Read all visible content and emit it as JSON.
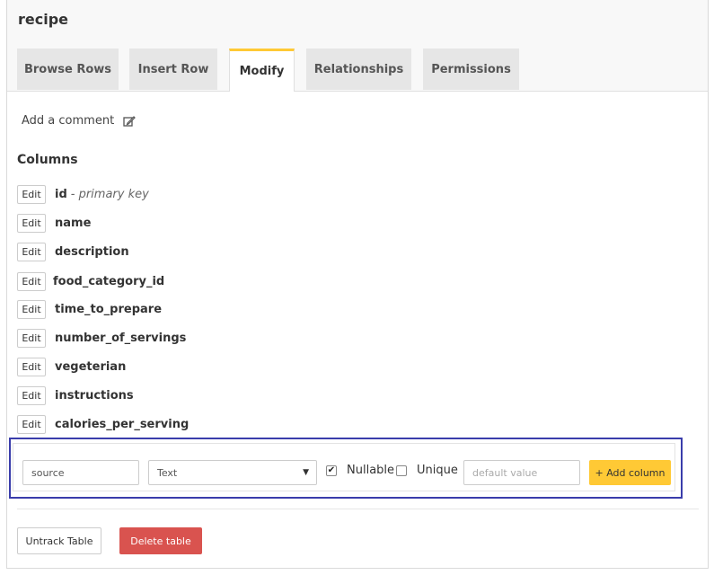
{
  "table_name": "recipe",
  "tabs": [
    {
      "label": "Browse Rows",
      "active": false
    },
    {
      "label": "Insert Row",
      "active": false
    },
    {
      "label": "Modify",
      "active": true
    },
    {
      "label": "Relationships",
      "active": false
    },
    {
      "label": "Permissions",
      "active": false
    }
  ],
  "comment": {
    "label": "Add a comment",
    "icon": "edit-icon"
  },
  "columns_section": {
    "title": "Columns",
    "edit_label": "Edit",
    "items": [
      {
        "name": "id",
        "note": "- primary key"
      },
      {
        "name": "name",
        "note": ""
      },
      {
        "name": "description",
        "note": ""
      },
      {
        "name": "food_category_id",
        "note": ""
      },
      {
        "name": "time_to_prepare",
        "note": ""
      },
      {
        "name": "number_of_servings",
        "note": ""
      },
      {
        "name": "vegeterian",
        "note": ""
      },
      {
        "name": "instructions",
        "note": ""
      },
      {
        "name": "calories_per_serving",
        "note": ""
      }
    ]
  },
  "add_column": {
    "name_value": "source",
    "type_value": "Text",
    "nullable_label": "Nullable",
    "nullable_checked": true,
    "unique_label": "Unique",
    "unique_checked": false,
    "default_placeholder": "default value",
    "button_label": "+ Add column"
  },
  "footer": {
    "untrack_label": "Untrack Table",
    "delete_label": "Delete table"
  },
  "colors": {
    "accent": "#ffc935",
    "danger": "#d9534f",
    "highlight_border": "#3a3dab"
  }
}
